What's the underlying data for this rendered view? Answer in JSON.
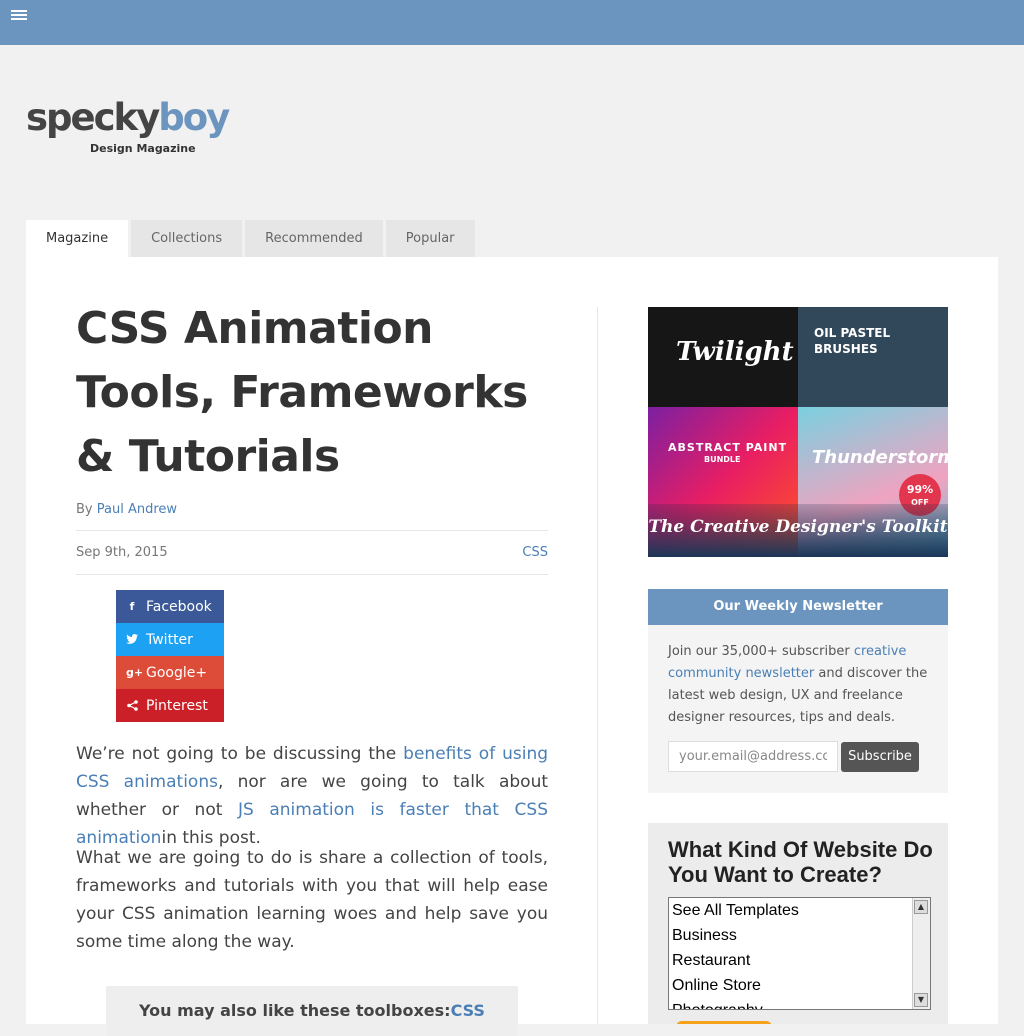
{
  "topbar": {
    "menu_icon": "hamburger-menu-icon",
    "color": "#6b94be"
  },
  "logo": {
    "word_a": "specky",
    "word_b": "boy",
    "tagline": "Design Magazine"
  },
  "tabs": [
    {
      "label": "Magazine",
      "active": true
    },
    {
      "label": "Collections",
      "active": false
    },
    {
      "label": "Recommended",
      "active": false
    },
    {
      "label": "Popular",
      "active": false
    }
  ],
  "article": {
    "title": "CSS Animation Tools, Frameworks & Tutorials",
    "byline_prefix": "By",
    "author": "Paul Andrew",
    "date": "Sep 9th, 2015",
    "category": "CSS",
    "share": [
      {
        "label": "Facebook",
        "icon": "facebook-icon",
        "color": "#3b5998"
      },
      {
        "label": "Twitter",
        "icon": "twitter-icon",
        "color": "#1da1f2"
      },
      {
        "label": "Google+",
        "icon": "google-plus-icon",
        "color": "#dd4b39"
      },
      {
        "label": "Pinterest",
        "icon": "share-icon",
        "color": "#cb2027"
      }
    ],
    "p1_a": "We’re not going to be discussing the",
    "p1_link1": "benefits of using CSS animations",
    "p1_b": ", nor are we going to talk about whether or not",
    "p1_link2": "JS animation is faster that CSS animation",
    "p1_c": "in this post.",
    "p2": "What we are going to do is share a collection of tools, frameworks and tutorials with you that will help ease your CSS animation learning woes and help save you some time along the way.",
    "toolbox_label": "You may also like these toolboxes:",
    "toolbox_link": "CSS"
  },
  "sidebar": {
    "ad": {
      "q1": "Twilight",
      "q2": "OIL PASTEL BRUSHES",
      "q3": "ABSTRACT PAINT",
      "q3b": "BUNDLE",
      "q4": "Thunderstorm",
      "badge_pct": "99%",
      "badge_off": "OFF",
      "strip": "The Creative Designer's Toolkit"
    },
    "newsletter": {
      "heading": "Our Weekly Newsletter",
      "text_a": "Join our 35,000+ subscriber",
      "link": "creative community newsletter",
      "text_b": "and discover the latest web design, UX and freelance designer resources, tips and deals.",
      "input_value": "your.email@address.com",
      "button": "Subscribe"
    },
    "ad2": {
      "title": "What Kind Of Website Do You Want to Create?",
      "options": [
        "See All Templates",
        "Business",
        "Restaurant",
        "Online Store",
        "Photography"
      ]
    }
  }
}
